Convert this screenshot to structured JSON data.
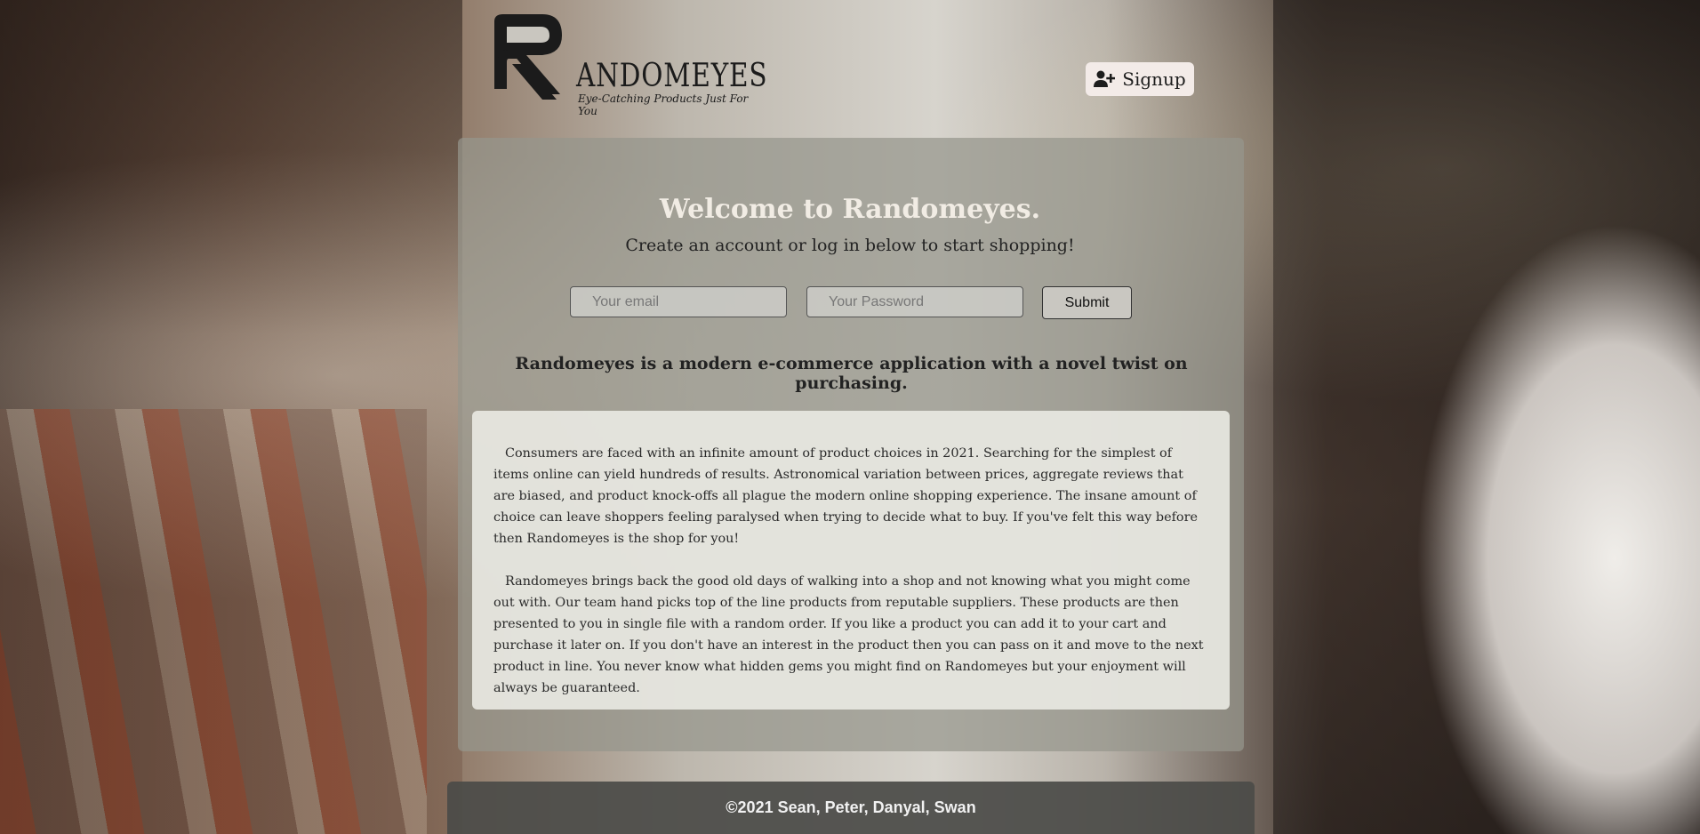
{
  "brand": {
    "name": "ANDOMEYES",
    "tagline": "Eye-Catching Products Just For You",
    "logo_icon": "stylized-r-logo"
  },
  "header": {
    "signup_label": "Signup",
    "signup_icon": "user-plus-icon"
  },
  "hero": {
    "welcome": "Welcome to Randomeyes.",
    "subtitle": "Create an account or log in below to start shopping!"
  },
  "login_form": {
    "email_placeholder": "Your email",
    "email_value": "",
    "password_placeholder": "Your Password",
    "password_value": "",
    "submit_label": "Submit"
  },
  "about": {
    "headline": "Randomeyes is a modern e-commerce application with a novel twist on purchasing.",
    "paragraphs": [
      "Consumers are faced with an infinite amount of product choices in 2021. Searching for the simplest of items online can yield hundreds of results. Astronomical variation between prices, aggregate reviews that are biased, and product knock-offs all plague the modern online shopping experience. The insane amount of choice can leave shoppers feeling paralysed when trying to decide what to buy. If you've felt this way before then Randomeyes is the shop for you!",
      "Randomeyes brings back the good old days of walking into a shop and not knowing what you might come out with. Our team hand picks top of the line products from reputable suppliers. These products are then presented to you in single file with a random order. If you like a product you can add it to your cart and purchase it later on. If you don't have an interest in the product then you can pass on it and move to the next product in line. You never know what hidden gems you might find on Randomeyes but your enjoyment will always be guaranteed."
    ]
  },
  "footer": {
    "copyright": "©2021 Sean, Peter, Danyal, Swan"
  },
  "colors": {
    "card_overlay": "#96968c",
    "signup_bg": "#f3ebe8",
    "footer_bg": "#4b4b48",
    "welcome_text": "#f1ece4"
  }
}
